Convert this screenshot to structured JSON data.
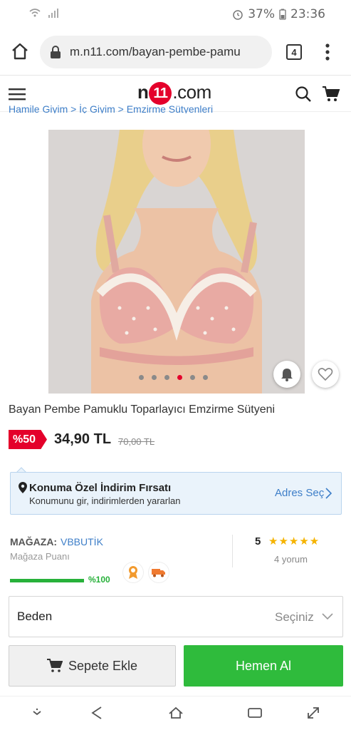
{
  "status_bar": {
    "battery": "37%",
    "time": "23:36"
  },
  "browser": {
    "url": "m.n11.com/bayan-pembe-pamu",
    "tab_count": "4"
  },
  "site": {
    "logo_prefix": "n",
    "logo_number": "11",
    "logo_suffix": ".com"
  },
  "breadcrumb": "Hamile Giyim > İç Giyim > Emzirme Sütyenleri",
  "gallery": {
    "image_count": 6,
    "active_index": 4
  },
  "product": {
    "title": "Bayan Pembe Pamuklu Toparlayıcı Emzirme Sütyeni",
    "discount": "%50",
    "price": "34,90 TL",
    "old_price": "70,00 TL"
  },
  "location_offer": {
    "title": "Konuma Özel İndirim Fırsatı",
    "subtitle": "Konumunu gir, indirimlerden yararlan",
    "link": "Adres Seç"
  },
  "store": {
    "label": "MAĞAZA:",
    "name": "VBBUTİK",
    "score_label": "Mağaza Puanı",
    "score_text": "%100",
    "score_fraction": 1.0,
    "rating": "5",
    "stars": "★★★★★",
    "reviews": "4 yorum"
  },
  "size": {
    "label": "Beden",
    "value": "Seçiniz"
  },
  "actions": {
    "add_to_cart": "Sepete Ekle",
    "buy_now": "Hemen Al"
  },
  "colors": {
    "brand_red": "#e4002b",
    "buy_green": "#2fbb3c",
    "link_blue": "#3d7ec8",
    "star_yellow": "#f5b300"
  }
}
